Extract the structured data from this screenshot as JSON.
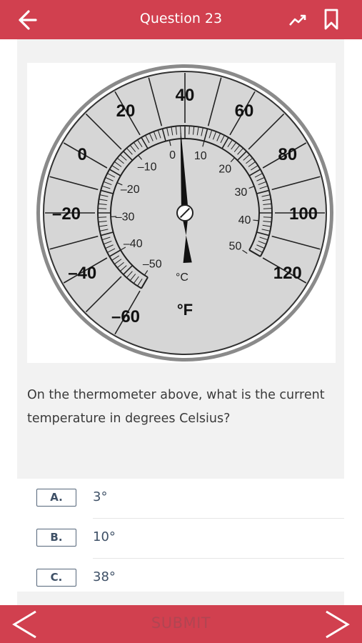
{
  "header": {
    "title": "Question 23",
    "back_icon": "arrow-left-icon",
    "progress_icon": "trend-up-icon",
    "bookmark_icon": "bookmark-icon"
  },
  "figure": {
    "fahrenheit_labels": [
      "-60",
      "-40",
      "-20",
      "0",
      "20",
      "40",
      "60",
      "80",
      "100",
      "120"
    ],
    "celsius_labels": [
      "-50",
      "-40",
      "-30",
      "-20",
      "-10",
      "0",
      "10",
      "20",
      "30",
      "40",
      "50"
    ],
    "fahrenheit_unit": "°F",
    "celsius_unit": "°C",
    "needle_reading_f": 38
  },
  "question": {
    "text": "On the thermometer above, what is the current temperature in degrees Celsius?"
  },
  "answers": [
    {
      "key": "A.",
      "text": "3°"
    },
    {
      "key": "B.",
      "text": "10°"
    },
    {
      "key": "C.",
      "text": "38°"
    }
  ],
  "footer": {
    "submit_label": "SUBMIT",
    "prev_icon": "chevron-left-icon",
    "next_icon": "chevron-right-icon"
  },
  "colors": {
    "brand": "#d1404f",
    "answer_text": "#3e5066"
  }
}
